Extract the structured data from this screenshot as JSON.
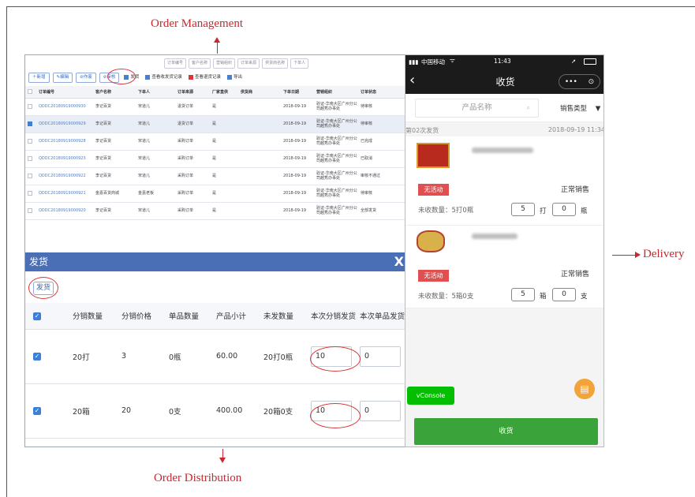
{
  "annotations": {
    "order_management": "Order Management",
    "order_distribution": "Order Distribution",
    "delivery": "Delivery"
  },
  "admin": {
    "filters": [
      "订单编号",
      "客户名称",
      "营销组织",
      "订单来源",
      "供货商名称",
      "下单人"
    ],
    "toolbar": {
      "add": "新增",
      "edit": "编辑",
      "void": "作废",
      "audit": "审核",
      "ship": "发货",
      "view_ship_records": "查看收发货记录",
      "view_return_records": "查看退货记录",
      "export": "导出"
    },
    "columns": [
      "订单编号",
      "客户名称",
      "下单人",
      "订单来源",
      "厂家直供",
      "供货商",
      "下单日期",
      "营销组织",
      "订单状态"
    ],
    "rows": [
      {
        "code": "QDDC20180919000930",
        "customer": "李记百货",
        "person": "宋道儿",
        "source": "退货订单",
        "direct": "是",
        "supplier": "",
        "date": "2018-09-19",
        "org": "验证-华南大区广州分公司越秀办事处",
        "status": "待审核",
        "checked": false
      },
      {
        "code": "QDDC20180919000929",
        "customer": "李记百货",
        "person": "宋道儿",
        "source": "退货订单",
        "direct": "是",
        "supplier": "",
        "date": "2018-09-19",
        "org": "验证-华南大区广州分公司越秀办事处",
        "status": "待审核",
        "checked": true
      },
      {
        "code": "QDDC20180919000928",
        "customer": "李记百货",
        "person": "宋道儿",
        "source": "采购订单",
        "direct": "是",
        "supplier": "",
        "date": "2018-09-19",
        "org": "验证-华南大区广州分公司越秀办事处",
        "status": "已完成",
        "checked": false
      },
      {
        "code": "QDDC20180919000923",
        "customer": "李记百货",
        "person": "宋道儿",
        "source": "采购订单",
        "direct": "是",
        "supplier": "",
        "date": "2018-09-19",
        "org": "验证-华南大区广州分公司越秀办事处",
        "status": "已取消",
        "checked": false
      },
      {
        "code": "QDDC20180919000922",
        "customer": "李记百货",
        "person": "宋道儿",
        "source": "采购订单",
        "direct": "是",
        "supplier": "",
        "date": "2018-09-19",
        "org": "验证-华南大区广州分公司越秀办事处",
        "status": "审核不通过",
        "checked": false
      },
      {
        "code": "QDDC20180919000921",
        "customer": "金嘉百货商城",
        "person": "金嘉老板",
        "source": "采购订单",
        "direct": "是",
        "supplier": "",
        "date": "2018-09-19",
        "org": "验证-华南大区广州分公司越秀办事处",
        "status": "待审核",
        "checked": false
      },
      {
        "code": "QDDC20180919000920",
        "customer": "李记百货",
        "person": "宋道儿",
        "source": "采购订单",
        "direct": "是",
        "supplier": "",
        "date": "2018-09-19",
        "org": "验证-华南大区广州分公司越秀办事处",
        "status": "全部发货",
        "checked": false
      }
    ],
    "dialog": {
      "title": "发货",
      "close": "X",
      "ship_button": "发货",
      "columns": [
        "分销数量",
        "分销价格",
        "单品数量",
        "产品小计",
        "未发数量",
        "本次分销发货",
        "本次单品发货"
      ],
      "rows": [
        {
          "dist_qty": "20打",
          "price": "3",
          "unit_qty": "0瓶",
          "subtotal": "60.00",
          "unshipped": "20打0瓶",
          "ship_dist": "10",
          "ship_unit": "0"
        },
        {
          "dist_qty": "20箱",
          "price": "20",
          "unit_qty": "0支",
          "subtotal": "400.00",
          "unshipped": "20箱0支",
          "ship_dist": "10",
          "ship_unit": "0"
        }
      ]
    }
  },
  "phone": {
    "carrier": "中国移动",
    "time": "11:43",
    "title": "收货",
    "capsule_more": "•••",
    "search_placeholder": "产品名称",
    "sale_type": "销售类型",
    "batch_label": "第02次发货",
    "batch_time": "2018-09-19 11:34",
    "items": [
      {
        "badge": "无活动",
        "sale": "正常销售",
        "unreceived": "未收数量：5打0瓶",
        "qty1": "5",
        "unit1": "打",
        "qty2": "0",
        "unit2": "瓶"
      },
      {
        "badge": "无活动",
        "sale": "正常销售",
        "unreceived": "未收数量：5箱0支",
        "qty1": "5",
        "unit1": "箱",
        "qty2": "0",
        "unit2": "支"
      }
    ],
    "vconsole": "vConsole",
    "receive_button": "收货"
  },
  "colors": {
    "accent_red": "#c8282d",
    "dialog_blue": "#4b6fb5",
    "green": "#3aa33a",
    "badge_red": "#e15050"
  }
}
